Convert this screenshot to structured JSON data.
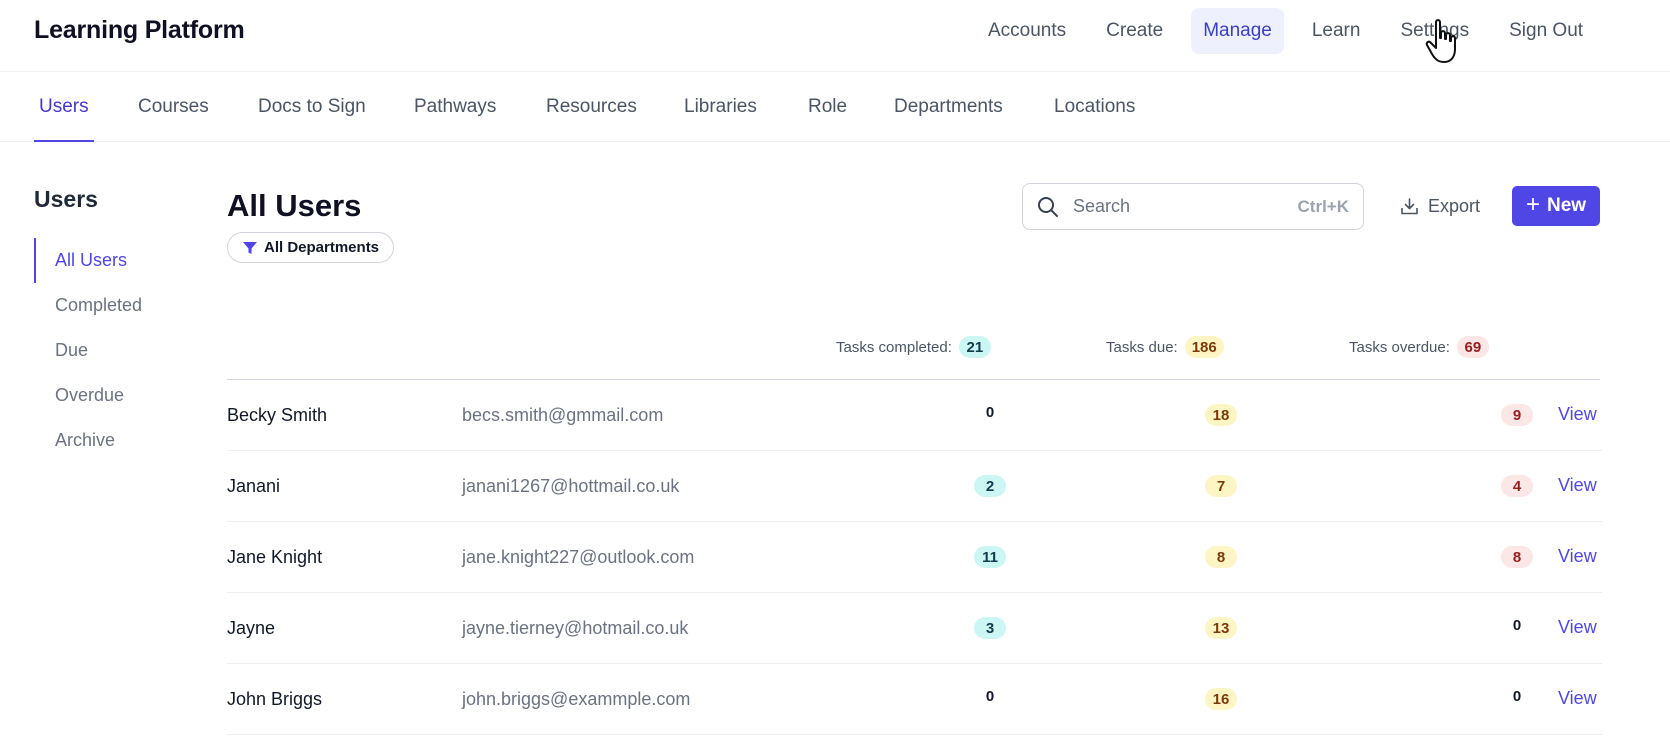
{
  "app": {
    "brand": "Learning Platform"
  },
  "topnav": [
    {
      "label": "Accounts",
      "active": false
    },
    {
      "label": "Create",
      "active": false
    },
    {
      "label": "Manage",
      "active": true
    },
    {
      "label": "Learn",
      "active": false
    },
    {
      "label": "Settings",
      "active": false
    },
    {
      "label": "Sign Out",
      "active": false
    }
  ],
  "subnav": [
    {
      "label": "Users",
      "active": true
    },
    {
      "label": "Courses"
    },
    {
      "label": "Docs to Sign"
    },
    {
      "label": "Pathways"
    },
    {
      "label": "Resources"
    },
    {
      "label": "Libraries"
    },
    {
      "label": "Role"
    },
    {
      "label": "Departments"
    },
    {
      "label": "Locations"
    }
  ],
  "sidebar": {
    "title": "Users",
    "items": [
      {
        "label": "All Users",
        "active": true
      },
      {
        "label": "Completed"
      },
      {
        "label": "Due"
      },
      {
        "label": "Overdue"
      },
      {
        "label": "Archive"
      }
    ]
  },
  "main": {
    "title": "All Users",
    "filter_label": "All Departments",
    "search": {
      "placeholder": "Search",
      "value": "",
      "shortcut": "Ctrl+K"
    },
    "export_label": "Export",
    "new_label": "New",
    "summary": {
      "completed_label": "Tasks completed:",
      "completed": "21",
      "due_label": "Tasks due:",
      "due": "186",
      "overdue_label": "Tasks overdue:",
      "overdue": "69"
    },
    "rows": [
      {
        "name": "Becky Smith",
        "email": "becs.smith@gmmail.com",
        "completed": "0",
        "due": "18",
        "overdue": "9",
        "action": "View"
      },
      {
        "name": "Janani",
        "email": "janani1267@hottmail.co.uk",
        "completed": "2",
        "due": "7",
        "overdue": "4",
        "action": "View"
      },
      {
        "name": "Jane Knight",
        "email": "jane.knight227@outlook.com",
        "completed": "11",
        "due": "8",
        "overdue": "8",
        "action": "View"
      },
      {
        "name": "Jayne",
        "email": "jayne.tierney@hotmail.co.uk",
        "completed": "3",
        "due": "13",
        "overdue": "0",
        "action": "View"
      },
      {
        "name": "John Briggs",
        "email": "john.briggs@exammple.com",
        "completed": "0",
        "due": "16",
        "overdue": "0",
        "action": "View"
      }
    ]
  },
  "colors": {
    "accent": "#4f46e5",
    "teal_badge": "#ccf6f4",
    "yellow_badge": "#fdf6c4",
    "red_badge": "#fce7e7"
  },
  "icons": {
    "search": "search-icon",
    "export": "download-icon",
    "filter": "filter-icon",
    "cursor": "hand-pointer-icon"
  }
}
